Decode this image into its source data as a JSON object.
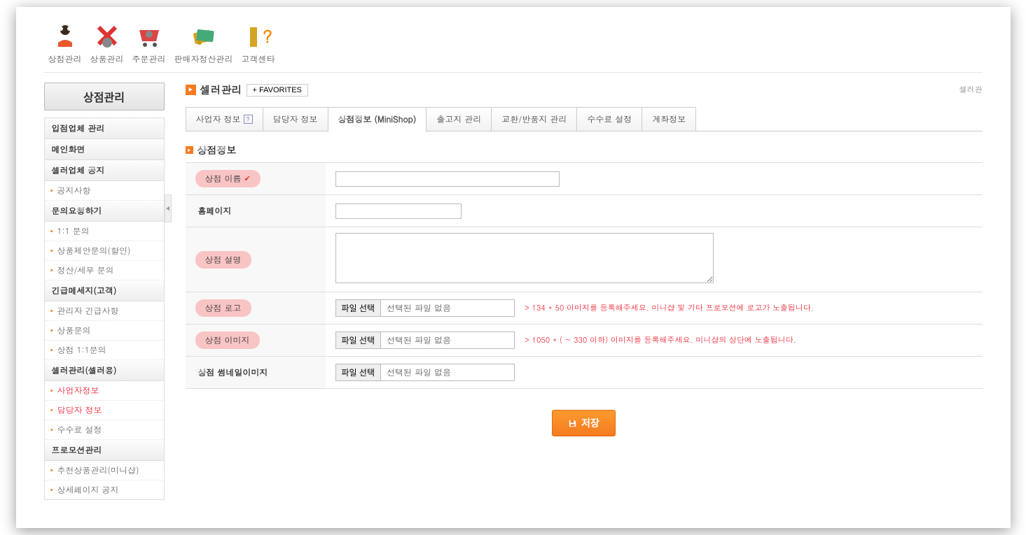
{
  "topnav": [
    {
      "label": "상점관리",
      "icon": "person"
    },
    {
      "label": "상품관리",
      "icon": "cancel"
    },
    {
      "label": "주문관리",
      "icon": "cart"
    },
    {
      "label": "판매자정산관리",
      "icon": "cards"
    },
    {
      "label": "고객센타",
      "icon": "question"
    }
  ],
  "sidebar": {
    "title": "상점관리",
    "groups": [
      {
        "head": "입점업체 관리",
        "items": []
      },
      {
        "head": "메인화면",
        "items": []
      },
      {
        "head": "셀러업체 공지",
        "items": [
          {
            "label": "공지사항"
          }
        ]
      },
      {
        "head": "문의요청하기",
        "items": [
          {
            "label": "1:1 문의"
          },
          {
            "label": "상품제안문의(할인)"
          },
          {
            "label": "정산/세무 문의"
          }
        ]
      },
      {
        "head": "긴급메세지(고객)",
        "items": [
          {
            "label": "관리자 긴급사항"
          },
          {
            "label": "상품문의"
          },
          {
            "label": "상점 1:1문의"
          }
        ]
      },
      {
        "head": "셀러관리(셀러용)",
        "items": [
          {
            "label": "사업자정보",
            "active": true
          },
          {
            "label": "담당자 정보",
            "active": true
          },
          {
            "label": "수수료 설정"
          }
        ]
      },
      {
        "head": "프로모션관리",
        "items": [
          {
            "label": "추천상품관리(미니샵)"
          },
          {
            "label": "상세페이지 공지"
          }
        ]
      }
    ]
  },
  "header": {
    "title": "셀러관리",
    "favorites": "+ FAVORITES",
    "breadcrumb": "셀러관"
  },
  "tabs": [
    {
      "label": "사업자 정보",
      "help": true
    },
    {
      "label": "담당자 정보"
    },
    {
      "label": "상점정보 (MiniShop)",
      "active": true
    },
    {
      "label": "출고지 관리"
    },
    {
      "label": "교환/반품지 관리"
    },
    {
      "label": "수수료 설정"
    },
    {
      "label": "계좌정보"
    }
  ],
  "section": {
    "title": "상점정보"
  },
  "form": {
    "shop_name": {
      "label": "상점 이름",
      "required": true,
      "value": ""
    },
    "homepage": {
      "label": "홈페이지",
      "value": ""
    },
    "shop_desc": {
      "label": "상점 설명",
      "value": ""
    },
    "shop_logo": {
      "label": "상점 로고",
      "btn": "파일 선택",
      "file_label": "선택된 파일 없음",
      "hint": "> 134 * 50 이미지를 등록해주세요. 미니샵 및 기타 프로모션에 로고가 노출됩니다."
    },
    "shop_image": {
      "label": "상점 이미지",
      "btn": "파일 선택",
      "file_label": "선택된 파일 없음",
      "hint": "> 1050 * ( ~ 330 이하) 이미지를 등록해주세요. 미니샵의 상단에 노출됩니다."
    },
    "shop_thumb": {
      "label": "상점 썸네일이미지",
      "btn": "파일 선택",
      "file_label": "선택된 파일 없음"
    }
  },
  "save": {
    "label": "저장"
  }
}
